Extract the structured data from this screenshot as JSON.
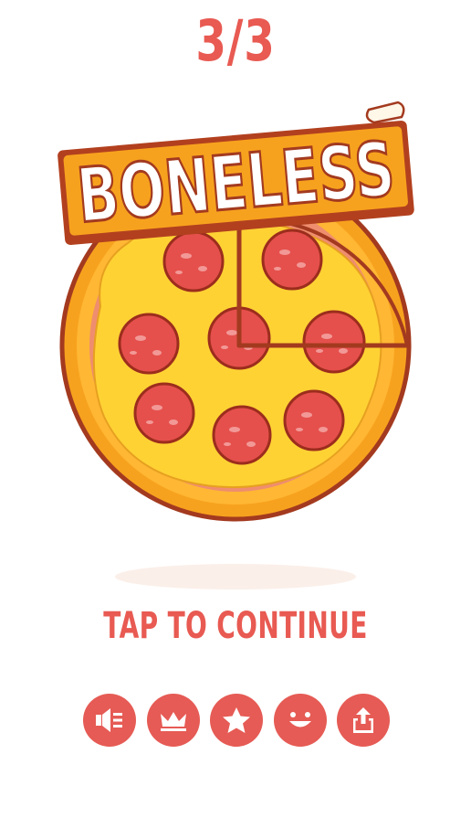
{
  "level": {
    "counter": "3/3"
  },
  "puzzle": {
    "title_word": "BONELESS",
    "item": "pizza",
    "topping": "pepperoni",
    "slices_cut": 1
  },
  "prompt": {
    "tap_text": "TAP TO CONTINUE"
  },
  "toolbar": {
    "buttons": [
      {
        "name": "sound",
        "icon": "speaker-icon"
      },
      {
        "name": "no-ads",
        "icon": "crown-icon"
      },
      {
        "name": "rate",
        "icon": "star-icon"
      },
      {
        "name": "more-games",
        "icon": "smiley-icon"
      },
      {
        "name": "share",
        "icon": "share-icon"
      }
    ]
  },
  "colors": {
    "accent": "#e65b55",
    "crust": "#f5a51c",
    "cheese": "#ffd234",
    "pepperoni": "#e5504c",
    "outline": "#9c2d1d"
  }
}
